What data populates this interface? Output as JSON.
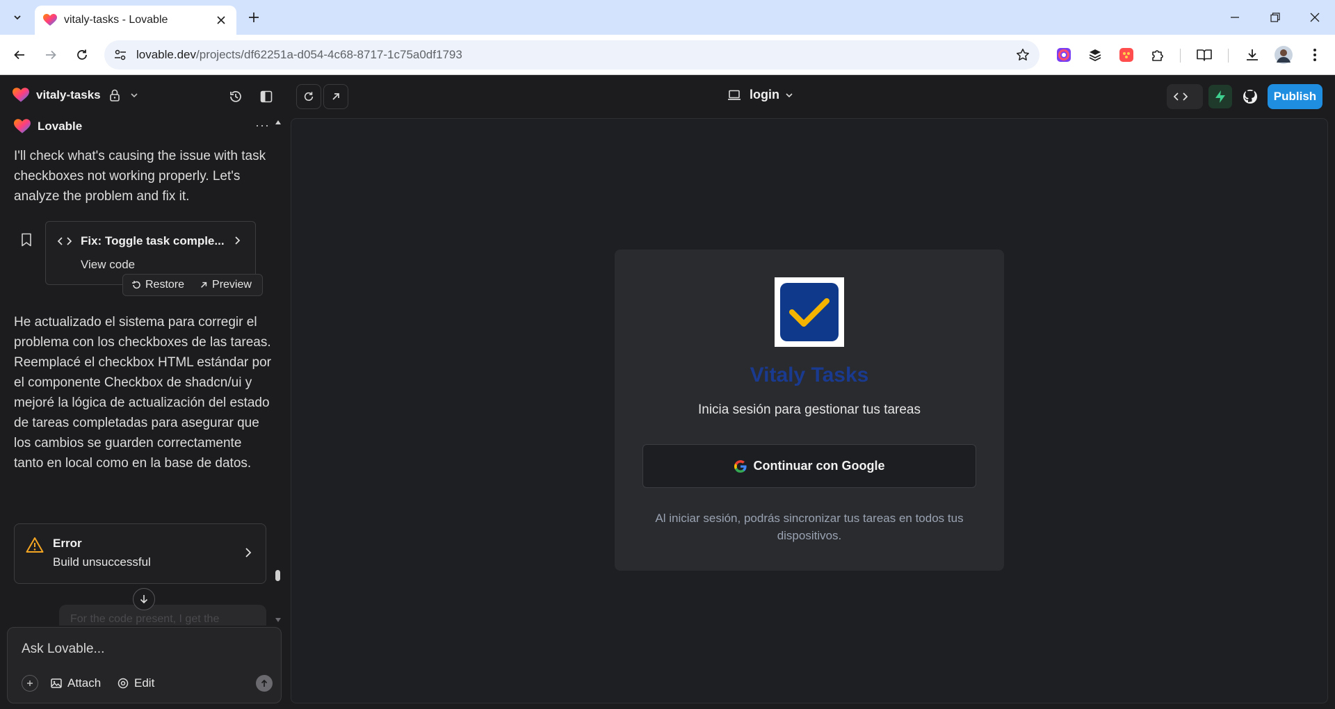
{
  "browser": {
    "tab_title": "vitaly-tasks - Lovable",
    "url_host": "lovable.dev",
    "url_path": "/projects/df62251a-d054-4c68-8717-1c75a0df1793"
  },
  "header": {
    "project_name": "vitaly-tasks",
    "route": "login",
    "publish_label": "Publish"
  },
  "chat": {
    "sender": "Lovable",
    "more": "···",
    "message1": "I'll check what's causing the issue with task checkboxes not working properly. Let's analyze the problem and fix it.",
    "card_title": "Fix: Toggle task comple...",
    "card_link": "View code",
    "restore_label": "Restore",
    "preview_label": "Preview",
    "message2": "He actualizado el sistema para corregir el problema con los checkboxes de las tareas. Reemplacé el checkbox HTML estándar por el componente Checkbox de shadcn/ui y mejoré la lógica de actualización del estado de tareas completadas para asegurar que los cambios se guarden correctamente tanto en local como en la base de datos.",
    "error_title": "Error",
    "error_text": "Build unsuccessful",
    "faded_text": "For the code present, I get the",
    "composer_placeholder": "Ask Lovable...",
    "attach_label": "Attach",
    "edit_label": "Edit"
  },
  "preview": {
    "app_title": "Vitaly Tasks",
    "subtitle": "Inicia sesión para gestionar tus tareas",
    "google_button": "Continuar con Google",
    "note": "Al iniciar sesión, podrás sincronizar tus tareas en todos tus dispositivos."
  },
  "colors": {
    "accent": "#1f8ee0",
    "logo_blue": "#0f3a8c",
    "logo_check": "#f5b400",
    "warning": "#f5a623"
  }
}
